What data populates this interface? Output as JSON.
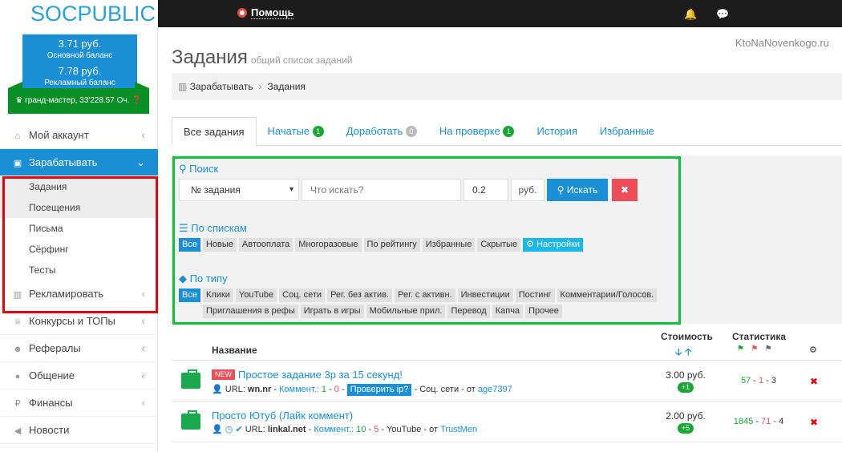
{
  "header": {
    "logo_part1": "SOC",
    "logo_part2": "PUBLIC",
    "help_label": "Помощь",
    "bell_glyph": "🔔",
    "chat_glyph": "💬"
  },
  "sidebar": {
    "main_balance": "3.71 руб.",
    "main_balance_label": "Основной баланс",
    "ad_balance": "7.78 руб.",
    "ad_balance_label": "Рекламный баланс",
    "rank": "гранд-мастер, 33'228.57 Оч.",
    "items": [
      {
        "label": "Мой аккаунт",
        "icon": "home-icon"
      },
      {
        "label": "Зарабатывать",
        "icon": "briefcase-icon"
      },
      {
        "label": "Рекламировать",
        "icon": "chart-icon"
      },
      {
        "label": "Конкурсы и ТОПы",
        "icon": "trophy-icon"
      },
      {
        "label": "Рефералы",
        "icon": "users-icon"
      },
      {
        "label": "Общение",
        "icon": "chat-icon"
      },
      {
        "label": "Финансы",
        "icon": "ruble-icon"
      },
      {
        "label": "Новости",
        "icon": "megaphone-icon"
      }
    ],
    "submenu": [
      "Задания",
      "Посещения",
      "Письма",
      "Сёрфинг",
      "Тесты"
    ]
  },
  "main": {
    "watermark": "KtoNaNovenkogo.ru",
    "title": "Задания",
    "subtitle": "общий список заданий",
    "breadcrumb": [
      "Зарабатывать",
      "Задания"
    ],
    "tabs": [
      {
        "label": "Все задания",
        "badge": ""
      },
      {
        "label": "Начатые",
        "badge": "1"
      },
      {
        "label": "Доработать",
        "badge": "0"
      },
      {
        "label": "На проверке",
        "badge": "1"
      },
      {
        "label": "История",
        "badge": ""
      },
      {
        "label": "Избранные",
        "badge": ""
      }
    ],
    "search": {
      "heading": "Поиск",
      "select_value": "№ задания",
      "query_placeholder": "Что искать?",
      "min_price": "0.2",
      "unit": "руб.",
      "search_button": "Искать",
      "clear_glyph": "✖"
    },
    "lists": {
      "heading": "По спискам",
      "chips": [
        "Все",
        "Новые",
        "Автооплата",
        "Многоразовые",
        "По рейтингу",
        "Избранные",
        "Скрытые"
      ],
      "settings": "Настройки"
    },
    "types": {
      "heading": "По типу",
      "chips": [
        "Все",
        "Клики",
        "YouTube",
        "Соц. сети",
        "Рег. без актив.",
        "Рег. с активн.",
        "Инвестиции",
        "Постинг",
        "Комментарии/Голосов.",
        "Приглашения в рефы",
        "Играть в игры",
        "Мобильные прил.",
        "Перевод",
        "Капча",
        "Прочее"
      ]
    },
    "table": {
      "col_name": "Название",
      "col_price": "Стоимость",
      "col_stats": "Статистика",
      "rows": [
        {
          "is_new": "NEW",
          "title": "Простое задание 3р за 15 секунд!",
          "url_label": "URL:",
          "url": "wn.nr",
          "comments_label": "Коммент.:",
          "comments_pos": "1",
          "comments_neg": "0",
          "check_ip": "Проверить ip?",
          "category": "Соц. сети",
          "from_label": "от",
          "author": "age7397",
          "price": "3.00 руб.",
          "price_badge": "+1",
          "stat_good": "57",
          "stat_bad": "1",
          "stat_other": "3"
        },
        {
          "is_new": "",
          "title": "Просто Ютуб (Лайк коммент)",
          "url_label": "URL:",
          "url": "linkal.net",
          "comments_label": "Коммент.:",
          "comments_pos": "10",
          "comments_neg": "5",
          "check_ip": "",
          "category": "YouTube",
          "from_label": "от",
          "author": "TrustMen",
          "price": "2.00 руб.",
          "price_badge": "+5",
          "stat_good": "1845",
          "stat_bad": "71",
          "stat_other": "4"
        }
      ]
    }
  },
  "colors": {
    "accent": "#1a8fd6",
    "success": "#18a635",
    "danger": "#ef4d5a",
    "highlight_red": "#e8000b",
    "highlight_green": "#11c13a"
  }
}
